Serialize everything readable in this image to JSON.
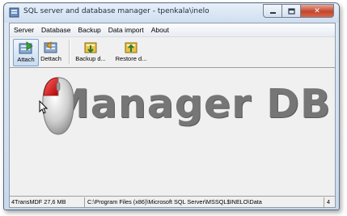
{
  "window": {
    "title": "SQL server and database manager - tpenkala\\inelo",
    "close_symbol": "✕"
  },
  "menu": {
    "items": [
      {
        "label": "Server"
      },
      {
        "label": "Database"
      },
      {
        "label": "Backup"
      },
      {
        "label": "Data import"
      },
      {
        "label": "About"
      }
    ]
  },
  "toolbar": {
    "attach_label": "Attach",
    "dettach_label": "Dettach",
    "backup_label": "Backup d...",
    "restore_label": "Restore d..."
  },
  "logo": {
    "text": "Manager DB"
  },
  "status": {
    "database": "4TransMDF  27,6 MB",
    "path": "C:\\Program Files (x86)\\Microsoft SQL Server\\MSSQL$INELO\\Data",
    "extra": "4"
  }
}
